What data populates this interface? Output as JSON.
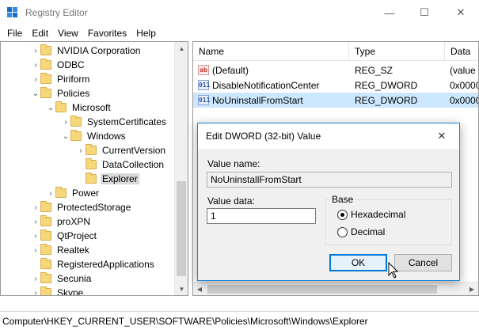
{
  "window": {
    "title": "Registry Editor",
    "controls": {
      "minimize": "—",
      "maximize": "☐",
      "close": "✕"
    }
  },
  "menu": [
    "File",
    "Edit",
    "View",
    "Favorites",
    "Help"
  ],
  "tree": {
    "items": [
      {
        "label": "NVIDIA Corporation",
        "level": 0,
        "expander": "›",
        "selected": false
      },
      {
        "label": "ODBC",
        "level": 0,
        "expander": "›",
        "selected": false
      },
      {
        "label": "Piriform",
        "level": 0,
        "expander": "›",
        "selected": false
      },
      {
        "label": "Policies",
        "level": 0,
        "expander": "⌄",
        "selected": false
      },
      {
        "label": "Microsoft",
        "level": 1,
        "expander": "⌄",
        "selected": false
      },
      {
        "label": "SystemCertificates",
        "level": 2,
        "expander": "›",
        "selected": false
      },
      {
        "label": "Windows",
        "level": 2,
        "expander": "⌄",
        "selected": false
      },
      {
        "label": "CurrentVersion",
        "level": 3,
        "expander": "›",
        "selected": false
      },
      {
        "label": "DataCollection",
        "level": 3,
        "expander": "",
        "selected": false
      },
      {
        "label": "Explorer",
        "level": 3,
        "expander": "",
        "selected": true
      },
      {
        "label": "Power",
        "level": 1,
        "expander": "›",
        "selected": false
      },
      {
        "label": "ProtectedStorage",
        "level": 0,
        "expander": "›",
        "selected": false
      },
      {
        "label": "proXPN",
        "level": 0,
        "expander": "›",
        "selected": false
      },
      {
        "label": "QtProject",
        "level": 0,
        "expander": "›",
        "selected": false
      },
      {
        "label": "Realtek",
        "level": 0,
        "expander": "›",
        "selected": false
      },
      {
        "label": "RegisteredApplications",
        "level": 0,
        "expander": "",
        "selected": false
      },
      {
        "label": "Secunia",
        "level": 0,
        "expander": "›",
        "selected": false
      },
      {
        "label": "Skype",
        "level": 0,
        "expander": "›",
        "selected": false
      }
    ]
  },
  "list": {
    "columns": [
      "Name",
      "Type",
      "Data"
    ],
    "rows": [
      {
        "icon": "ab",
        "name": "(Default)",
        "type": "REG_SZ",
        "data": "(value",
        "selected": false
      },
      {
        "icon": "011",
        "name": "DisableNotificationCenter",
        "type": "REG_DWORD",
        "data": "0x0000",
        "selected": false
      },
      {
        "icon": "011",
        "name": "NoUninstallFromStart",
        "type": "REG_DWORD",
        "data": "0x0000",
        "selected": true
      }
    ]
  },
  "status": "Computer\\HKEY_CURRENT_USER\\SOFTWARE\\Policies\\Microsoft\\Windows\\Explorer",
  "dialog": {
    "title": "Edit DWORD (32-bit) Value",
    "value_name_label": "Value name:",
    "value_name": "NoUninstallFromStart",
    "value_data_label": "Value data:",
    "value_data": "1",
    "base_label": "Base",
    "base_options": [
      "Hexadecimal",
      "Decimal"
    ],
    "base_selected": "Hexadecimal",
    "ok_label": "OK",
    "cancel_label": "Cancel",
    "close": "✕"
  },
  "colors": {
    "selection": "#cce8ff",
    "accent": "#0078d7",
    "folder": "#f6d77a"
  }
}
